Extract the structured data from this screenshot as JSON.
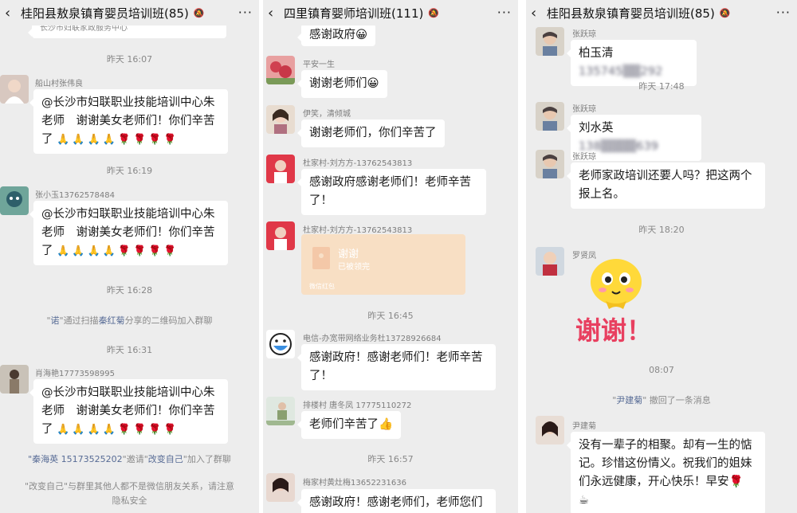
{
  "panels": [
    {
      "title": "桂阳县敖泉镇育婴员培训班(85)",
      "top_partial": "长沙市妇联家政服务中心",
      "time1": "昨天 16:07",
      "msg1": {
        "sender": "船山村张伟良",
        "line1": "@长沙市妇联职业技能培训中心朱",
        "line2": "老师　谢谢美女老师们！你们辛苦",
        "line3": "了"
      },
      "time2": "昨天 16:19",
      "msg2": {
        "sender": "张小玉13762578484",
        "line1": "@长沙市妇联职业技能培训中心朱",
        "line2": "老师　谢谢美女老师们！你们辛苦",
        "line3": "了"
      },
      "time3": "昨天 16:28",
      "sys1": {
        "quote_open": "\"",
        "name": "诺",
        "quote_close": "\"",
        "text1": "通过扫描",
        "name2": "秦红菊",
        "text2": "分享的二维码加入群聊"
      },
      "time4": "昨天 16:31",
      "msg3": {
        "sender": "肖海艳17773598995",
        "line1": "@长沙市妇联职业技能培训中心朱",
        "line2": "老师　谢谢美女老师们！你们辛苦",
        "line3": "了"
      },
      "sys2": {
        "name": "\"秦海英 15173525202",
        "text1": "\"邀请\"",
        "name2": "改变自己",
        "text2": "\"加入了群聊"
      },
      "sys3": {
        "line1": "\"改变自己\"与群里其他人都不是微信朋友关系，请注意",
        "line2": "隐私安全"
      },
      "emoji_tail": "🙏🙏🙏🙏🌹🌹🌹🌹"
    },
    {
      "title": "四里镇育婴师培训班(111)",
      "msg0": {
        "text": "感谢政府😀"
      },
      "msg1": {
        "sender": "平安一生",
        "text": "谢谢老师们😀"
      },
      "msg2": {
        "sender": "伊笑，清倾城",
        "text": "谢谢老师们，你们辛苦了"
      },
      "msg3": {
        "sender": "杜家村-刘方方-13762543813",
        "line1": "感谢政府感谢老师们！老师辛苦",
        "line2": "了！"
      },
      "msg4": {
        "sender": "杜家村-刘方方-13762543813",
        "rp_title": "谢谢",
        "rp_sub": "已被领完",
        "rp_foot": "微信红包"
      },
      "time1": "昨天 16:45",
      "msg5": {
        "sender": "电信-办宽带网络业务杜13728926684",
        "line1": "感谢政府！感谢老师们！老师辛苦",
        "line2": "了！"
      },
      "msg6": {
        "sender": "排楼村 唐冬凤 17775110272",
        "text": "老师们辛苦了👍"
      },
      "time2": "昨天 16:57",
      "msg7": {
        "sender": "梅家村黄灶梅13652231636",
        "text": "感谢政府！感谢老师们，老师您们"
      }
    },
    {
      "title": "桂阳县敖泉镇育婴员培训班(85)",
      "msg1": {
        "sender": "张跃琼",
        "name": "柏玉清",
        "phone": "135745▒▒292"
      },
      "time1": "昨天 17:48",
      "msg2": {
        "sender": "张跃琼",
        "name": "刘水英",
        "phone": "138▒▒▒▒639"
      },
      "msg3": {
        "sender": "张跃琼",
        "line1": "老师家政培训还要人吗？把这两个",
        "line2": "报上名。"
      },
      "time2": "昨天 18:20",
      "msg4": {
        "sender": "罗贤凤",
        "sticker_text": "谢谢！"
      },
      "time3": "08:07",
      "sys1": {
        "quote_open": "\"",
        "name": "尹建菊",
        "text": "\" 撤回了一条消息"
      },
      "msg5": {
        "sender": "尹建菊",
        "line1": "没有一辈子的相聚。却有一生的惦",
        "line2": "记。珍惜这份情义。祝我们的姐妹",
        "line3": "们永远健康，开心快乐！早安🌹",
        "line4": "☕"
      }
    }
  ],
  "icons": {
    "back": "‹",
    "more": "···",
    "mute": "🔕"
  }
}
